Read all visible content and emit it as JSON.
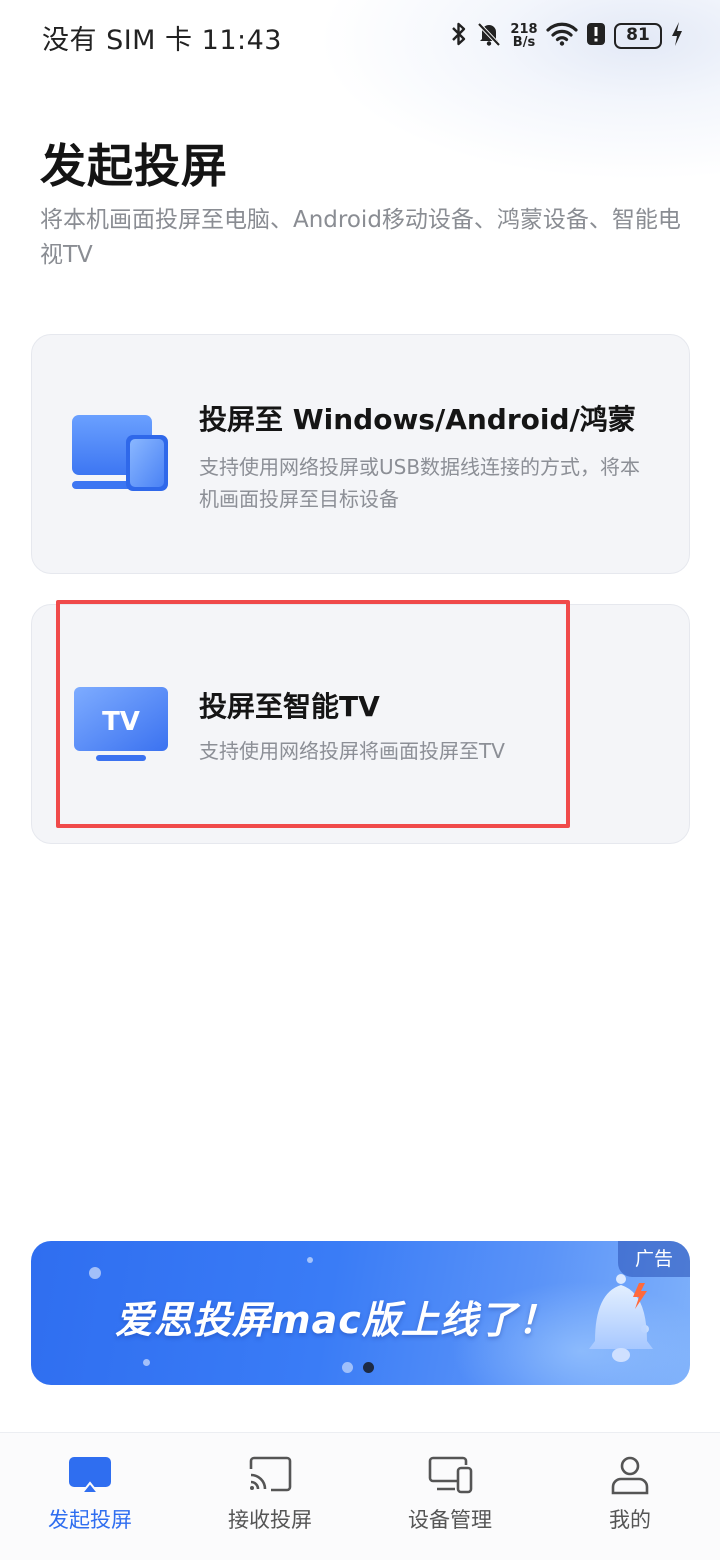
{
  "status_bar": {
    "left_text": "没有 SIM 卡 11:43",
    "net_speed_value": "218",
    "net_speed_unit": "B/s",
    "battery": "81",
    "icons": [
      "bluetooth-icon",
      "mute-bell-icon",
      "wifi-icon",
      "alert-icon",
      "battery-icon",
      "charging-icon"
    ]
  },
  "header": {
    "title": "发起投屏",
    "subtitle": "将本机画面投屏至电脑、Android移动设备、鸿蒙设备、智能电视TV"
  },
  "cards": [
    {
      "title": "投屏至 Windows/Android/鸿蒙",
      "description": "支持使用网络投屏或USB数据线连接的方式，将本机画面投屏至目标设备",
      "icon": "devices-icon"
    },
    {
      "title": "投屏至智能TV",
      "description": "支持使用网络投屏将画面投屏至TV",
      "icon": "tv-icon",
      "icon_text": "TV"
    }
  ],
  "banner": {
    "text": "爱思投屏mac版上线了！",
    "ad_label": "广告",
    "page_count": 2,
    "active_page": 2
  },
  "bottom_nav": [
    {
      "label": "发起投屏",
      "icon": "cast-screen-icon",
      "active": true
    },
    {
      "label": "接收投屏",
      "icon": "receive-cast-icon",
      "active": false
    },
    {
      "label": "设备管理",
      "icon": "device-manage-icon",
      "active": false
    },
    {
      "label": "我的",
      "icon": "profile-icon",
      "active": false
    }
  ],
  "colors": {
    "accent": "#2f6ef0",
    "highlight": "#f04a4a",
    "card_bg": "#f4f5f8"
  }
}
